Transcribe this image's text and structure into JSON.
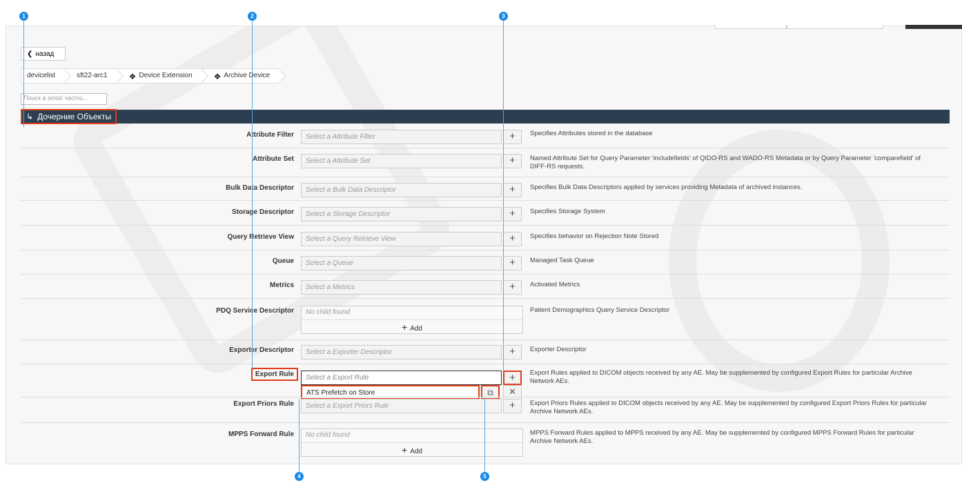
{
  "navigation": {
    "back_label": "назад",
    "breadcrumbs": [
      "devicelist",
      "sft22-arc1",
      "Device Extension",
      "Archive Device"
    ]
  },
  "search": {
    "placeholder": "Поиск в этой части..."
  },
  "section": {
    "title": "Дочерние Объекты"
  },
  "rows": [
    {
      "label": "Attribute Filter",
      "select": "Select a Attribute Filter",
      "desc": "Specifies Attributes stored in the database"
    },
    {
      "label": "Attribute Set",
      "select": "Select a Attribute Set",
      "desc": "Named Attribute Set for Query Parameter 'includefields' of QIDO-RS and WADO-RS Metadata or by Query Parameter 'comparefield' of DIFF-RS requests."
    },
    {
      "label": "Bulk Data Descriptor",
      "select": "Select a Bulk Data Descriptor",
      "desc": "Specifies Bulk Data Descriptors applied by services providing Metadata of archived instances."
    },
    {
      "label": "Storage Descriptor",
      "select": "Select a Storage Descriptor",
      "desc": "Specifies Storage System"
    },
    {
      "label": "Query Retrieve View",
      "select": "Select a Query Retrieve View",
      "desc": "Specifies behavior on Rejection Note Stored"
    },
    {
      "label": "Queue",
      "select": "Select a Queue",
      "desc": "Managed Task Queue"
    },
    {
      "label": "Metrics",
      "select": "Select a Metrics",
      "desc": "Activated Metrics"
    },
    {
      "label": "PDQ Service Descriptor",
      "no_child": "No child found",
      "add": "Add",
      "desc": "Patient Demographics Query Service Descriptor"
    },
    {
      "label": "Exporter Descriptor",
      "select": "Select a Exporter Descriptor",
      "desc": "Exporter Descriptor"
    },
    {
      "label": "Export Rule",
      "select": "Select a Export Rule",
      "item": "ATS Prefetch on Store",
      "desc": "Export Rules applied to DICOM objects received by any AE. May be supplemented by configured Export Rules for particular Archive Network AEs."
    },
    {
      "label": "Export Priors Rule",
      "select": "Select a Export Priors Rule",
      "desc": "Export Priors Rules applied to DICOM objects received by any AE. May be supplemented by configured Export Priors Rules for particular Archive Network AEs."
    },
    {
      "label": "MPPS Forward Rule",
      "no_child": "No child found",
      "add": "Add",
      "desc": "MPPS Forward Rules applied to MPPS received by any AE. May be supplemented by configured MPPS Forward Rules for particular Archive Network AEs."
    }
  ],
  "callouts": [
    "1",
    "2",
    "3",
    "4",
    "5"
  ],
  "colors": {
    "header": "#2d3e50",
    "highlight": "#e03c1a",
    "callout": "#1a8ae5"
  }
}
